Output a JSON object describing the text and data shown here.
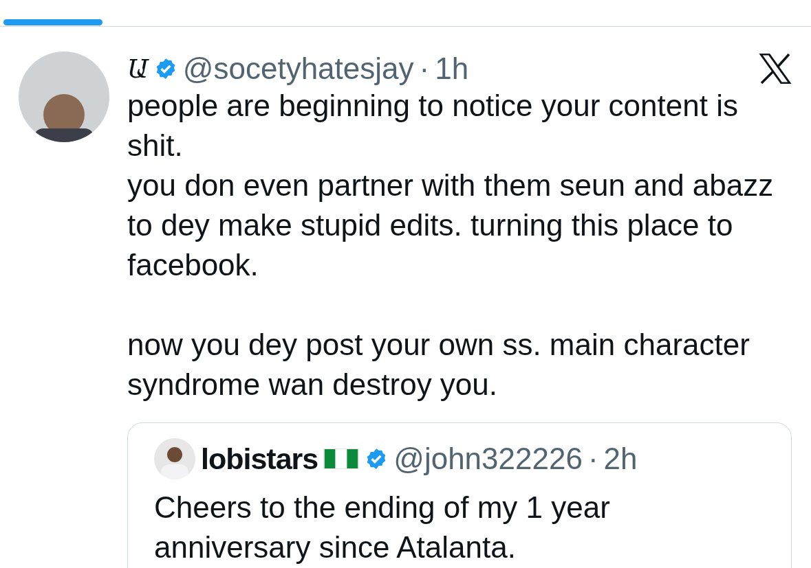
{
  "tabs": [
    {
      "selected": true
    }
  ],
  "tweet": {
    "display_name": "Ա",
    "verified": true,
    "handle": "@socetyhatesjay",
    "separator": "·",
    "time": "1h",
    "text": "people are beginning to notice your content is shit.\nyou don even partner with them seun and abazz to dey make stupid edits. turning this place to facebook.\n\nnow you dey post your own ss. main character syndrome wan destroy you.",
    "quoted": {
      "display_name": "lobistars",
      "flag": true,
      "verified": true,
      "handle": "@john322226",
      "separator": "·",
      "time": "2h",
      "text": "Cheers to the ending of my 1 year anniversary since Atalanta."
    }
  }
}
